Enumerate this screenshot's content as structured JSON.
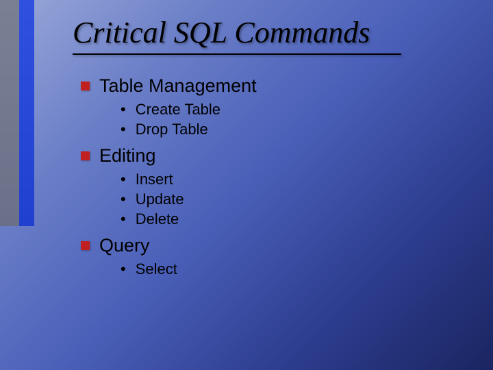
{
  "title": "Critical SQL Commands",
  "sections": [
    {
      "heading": "Table Management",
      "items": [
        "Create Table",
        "Drop Table"
      ]
    },
    {
      "heading": "Editing",
      "items": [
        "Insert",
        "Update",
        "Delete"
      ]
    },
    {
      "heading": "Query",
      "items": [
        "Select"
      ]
    }
  ]
}
